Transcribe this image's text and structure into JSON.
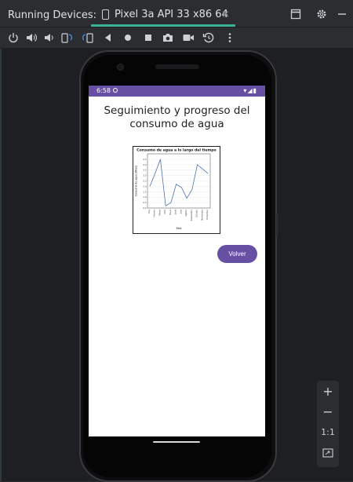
{
  "tool_window": {
    "title": "Running Devices:",
    "tab": {
      "label": "Pixel 3a API 33 x86 64",
      "close": "×"
    }
  },
  "header_icons": [
    "restore-layout-icon",
    "gear-icon",
    "minimize-icon"
  ],
  "device_toolbar": {
    "icons": [
      "power-icon",
      "volume-up-icon",
      "volume-down-icon",
      "rotate-left-icon",
      "rotate-right-icon",
      "back-icon",
      "home-icon",
      "overview-icon",
      "screenshot-icon",
      "screen-record-icon",
      "snapshot-icon",
      "more-icon"
    ]
  },
  "device": {
    "status_bar": {
      "time": "6:58",
      "icons": "▾◢▮"
    },
    "app": {
      "title": "Seguimiento y progreso del consumo de agua",
      "back_button": "Volver",
      "accent_color": "#6750a4"
    }
  },
  "zoom_controls": {
    "zoom_in": "+",
    "zoom_out": "−",
    "actual_size": "1:1",
    "fit_icon": "fit-screen-icon"
  },
  "chart_data": {
    "type": "line",
    "title": "Consumo de agua a lo largo del tiempo",
    "xlabel": "Mes",
    "ylabel": "Consumo de agua (litros)",
    "categories": [
      "Ene",
      "Febrero",
      "Marzo",
      "Abril",
      "Mayo",
      "Junio",
      "Julio",
      "Agosto",
      "Septiembre",
      "Octubre",
      "Noviembre",
      "Diciembre"
    ],
    "series": [
      {
        "values": [
          2.0,
          3.2,
          4.5,
          0.2,
          0.5,
          2.2,
          1.9,
          0.9,
          1.7,
          4.0,
          3.6,
          3.2
        ]
      }
    ],
    "ylim": [
      0,
      5
    ],
    "yticks": [
      "0.0",
      "0.5",
      "1.0",
      "1.5",
      "2.0",
      "2.5",
      "3.0",
      "3.5",
      "4.0",
      "4.5"
    ],
    "grid": true,
    "line_color": "#4c72b0"
  }
}
